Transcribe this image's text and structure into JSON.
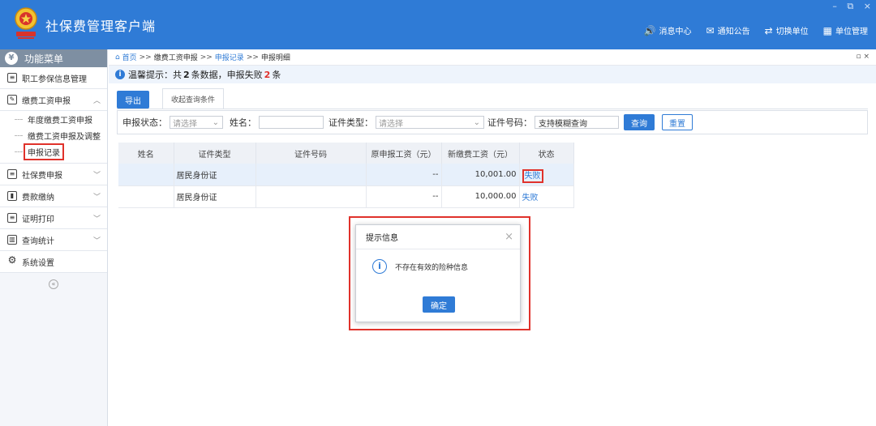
{
  "window": {
    "title": "社保费管理客户端",
    "controls": [
      "–",
      "⧉",
      "×"
    ]
  },
  "top_nav": [
    {
      "icon": "speaker-icon",
      "glyph": "🔊",
      "label": "消息中心"
    },
    {
      "icon": "mail-icon",
      "glyph": "✉",
      "label": "通知公告"
    },
    {
      "icon": "switch-icon",
      "glyph": "⇄",
      "label": "切换单位"
    },
    {
      "icon": "building-icon",
      "glyph": "▦",
      "label": "单位管理"
    }
  ],
  "sidebar": {
    "header": "功能菜单",
    "items": [
      {
        "label": "职工参保信息管理",
        "icon": "≡"
      },
      {
        "label": "缴费工资申报",
        "icon": "✎",
        "expanded": true
      },
      {
        "label": "社保费申报",
        "icon": "≡"
      },
      {
        "label": "费款缴纳",
        "icon": "▮"
      },
      {
        "label": "证明打印",
        "icon": "≡"
      },
      {
        "label": "查询统计",
        "icon": "▥"
      },
      {
        "label": "系统设置",
        "icon": "⚙"
      }
    ],
    "subitems": [
      "年度缴费工资申报",
      "缴费工资申报及调整",
      "申报记录"
    ]
  },
  "breadcrumb": {
    "home": "首页",
    "sep": ">>",
    "b1": "缴费工资申报",
    "b2": "申报记录",
    "b3": "申报明细"
  },
  "hint": {
    "prefix": "温馨提示：共",
    "total": "2",
    "middle": "条数据，申报失败",
    "failed": "2",
    "suffix": "条"
  },
  "toolbar": {
    "export": "导出",
    "tab": "收起查询条件"
  },
  "filter": {
    "status_label": "申报状态：",
    "status_placeholder": "请选择",
    "name_label": "姓名：",
    "name_value": "",
    "id_type_label": "证件类型：",
    "id_type_placeholder": "请选择",
    "id_no_label": "证件号码：",
    "id_no_value": "支持模糊查询",
    "query": "查询",
    "reset": "重置"
  },
  "table": {
    "headers": [
      "姓名",
      "证件类型",
      "证件号码",
      "原申报工资（元）",
      "新缴费工资（元）",
      "状态"
    ],
    "rows": [
      {
        "name": "",
        "id_type": "居民身份证",
        "id_no": "",
        "old_wage": "--",
        "new_wage": "10,001.00",
        "status": "失败"
      },
      {
        "name": "",
        "id_type": "居民身份证",
        "id_no": "",
        "old_wage": "--",
        "new_wage": "10,000.00",
        "status": "失败"
      }
    ]
  },
  "dialog": {
    "title": "提示信息",
    "message": "不存在有效的险种信息",
    "ok": "确定",
    "close": "×"
  },
  "colors": {
    "primary": "#2f7bd6",
    "highlight": "#e0322b"
  }
}
